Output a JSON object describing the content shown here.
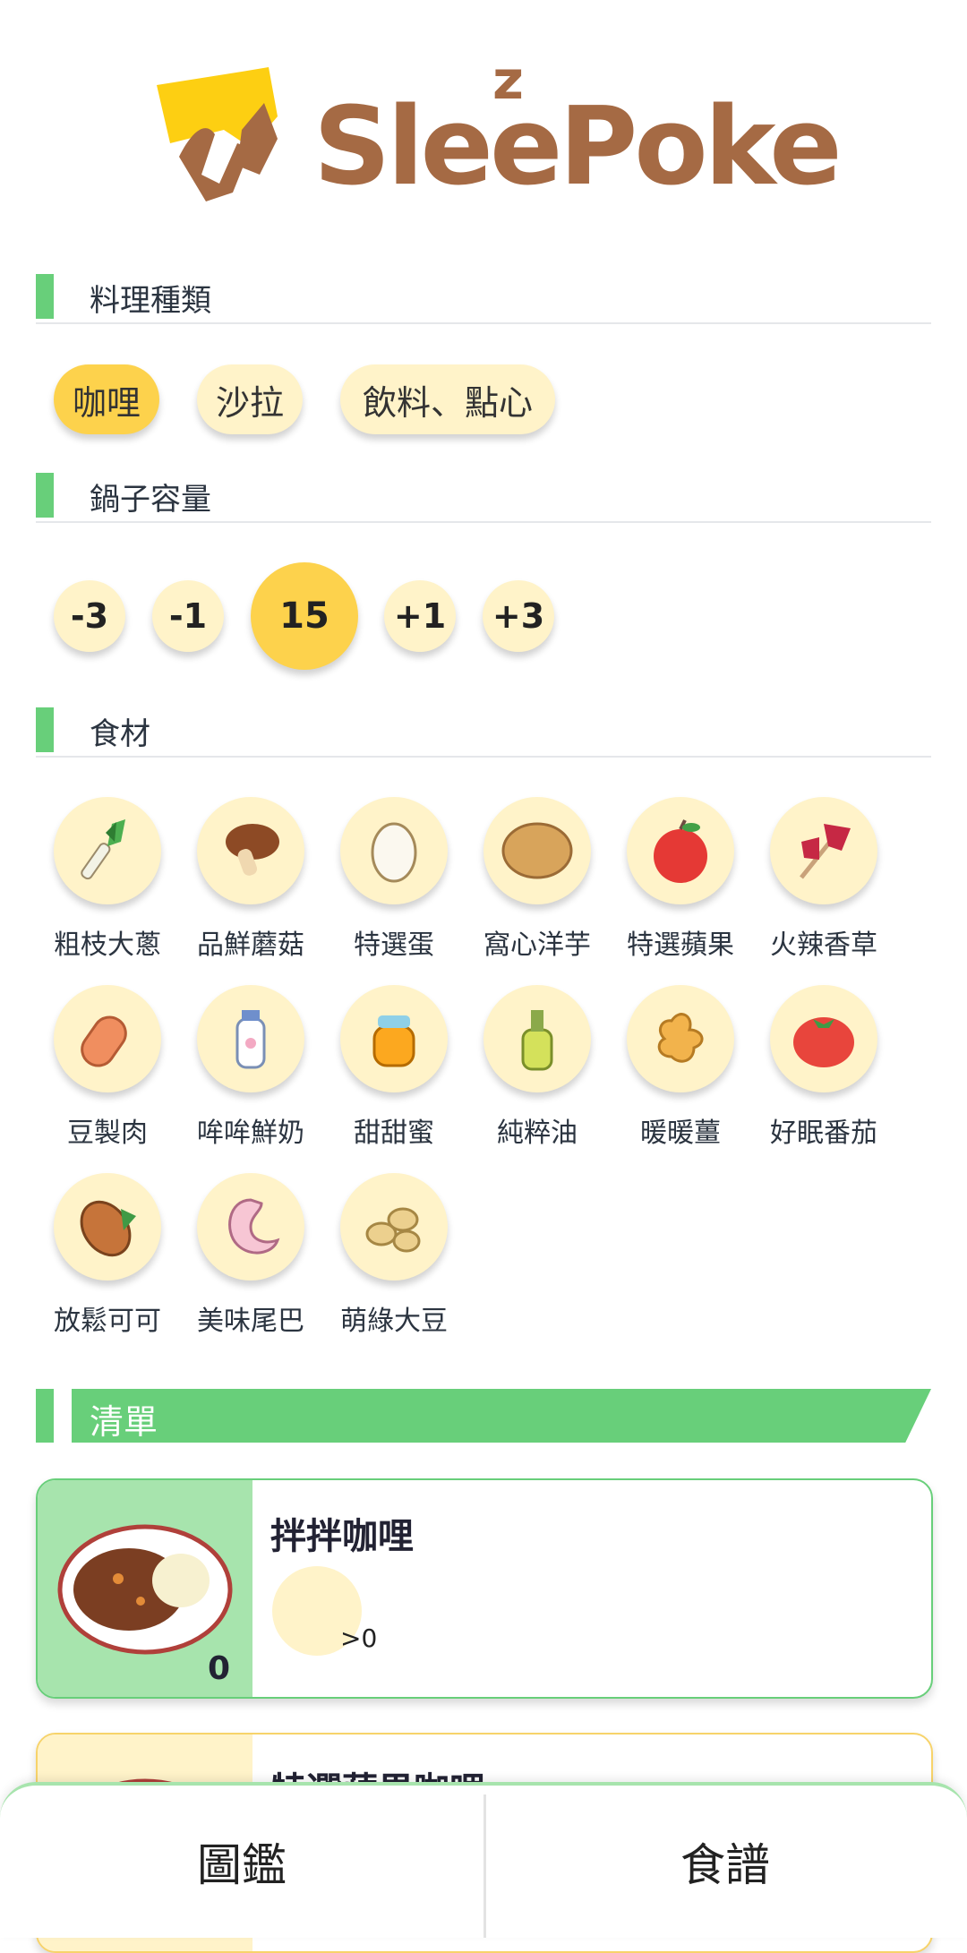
{
  "app": {
    "logo_text": "SleePoke"
  },
  "sections": {
    "cuisine_title": "料理種類",
    "pot_title": "鍋子容量",
    "ingredients_title": "食材",
    "list_title": "清單"
  },
  "cuisine": {
    "options": [
      "咖哩",
      "沙拉",
      "飲料、點心"
    ],
    "selected": "咖哩"
  },
  "pot": {
    "buttons": [
      "-3",
      "-1",
      "15",
      "+1",
      "+3"
    ],
    "value": "15"
  },
  "ingredients": [
    {
      "label": "粗枝大蔥",
      "icon": "leek-icon"
    },
    {
      "label": "品鮮蘑菇",
      "icon": "mushroom-icon"
    },
    {
      "label": "特選蛋",
      "icon": "egg-icon"
    },
    {
      "label": "窩心洋芋",
      "icon": "potato-icon"
    },
    {
      "label": "特選蘋果",
      "icon": "apple-icon"
    },
    {
      "label": "火辣香草",
      "icon": "herb-icon"
    },
    {
      "label": "豆製肉",
      "icon": "soy-meat-icon"
    },
    {
      "label": "哞哞鮮奶",
      "icon": "milk-icon"
    },
    {
      "label": "甜甜蜜",
      "icon": "honey-icon"
    },
    {
      "label": "純粹油",
      "icon": "oil-icon"
    },
    {
      "label": "暖暖薑",
      "icon": "ginger-icon"
    },
    {
      "label": "好眠番茄",
      "icon": "tomato-icon"
    },
    {
      "label": "放鬆可可",
      "icon": "cacao-icon"
    },
    {
      "label": "美味尾巴",
      "icon": "tail-icon"
    },
    {
      "label": "萌綠大豆",
      "icon": "soybean-icon"
    }
  ],
  "recipes": [
    {
      "name": "拌拌咖哩",
      "count": "0",
      "requirement": ">0",
      "icon": "curry-plate-icon"
    },
    {
      "name": "特選蘋果咖哩",
      "icon": "curry-plate-icon"
    }
  ],
  "nav": {
    "tabs": [
      "圖鑑",
      "食譜"
    ]
  },
  "colors": {
    "accent_green": "#68cf7a",
    "accent_yellow": "#fdd24c",
    "chip_bg": "#fff3c9",
    "logo_brown": "#a56a44"
  }
}
